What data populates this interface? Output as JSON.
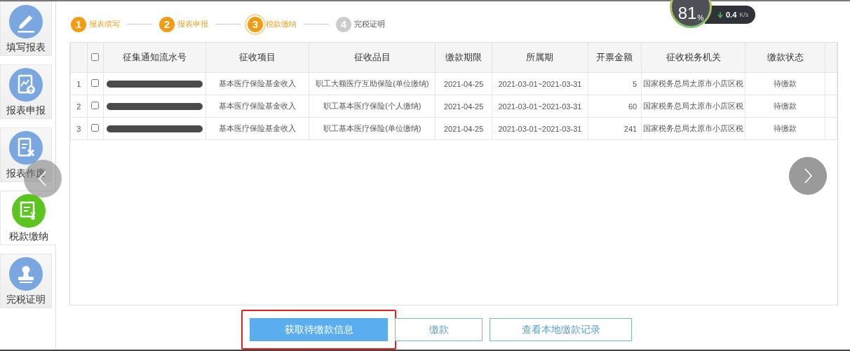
{
  "sidebar": {
    "items": [
      {
        "label": "填写报表",
        "selected": false
      },
      {
        "label": "报表申报",
        "selected": false
      },
      {
        "label": "报表作废",
        "selected": false
      },
      {
        "label": "税款缴纳",
        "selected": true
      },
      {
        "label": "完税证明",
        "selected": false
      }
    ]
  },
  "steps": [
    {
      "number": "1",
      "label": "报表填写",
      "kind": "done"
    },
    {
      "number": "2",
      "label": "报表申报",
      "kind": "done"
    },
    {
      "number": "3",
      "label": "税款缴纳",
      "kind": "current"
    },
    {
      "number": "4",
      "label": "完税证明",
      "kind": "todo"
    }
  ],
  "table": {
    "select_all": {
      "checked": false
    },
    "columns": [
      "征集通知流水号",
      "征收项目",
      "征收品目",
      "缴款期限",
      "所属期",
      "开票金额",
      "征收税务机关",
      "缴款状态"
    ],
    "rows": [
      {
        "index": "1",
        "checked": false,
        "item": "基本医疗保险基金收入",
        "category": "职工大额医疗互助保险(单位缴纳)",
        "deadline": "2021-04-25",
        "period": "2021-03-01~2021-03-31",
        "amount": "5",
        "authority": "国家税务总局太原市小店区税",
        "status": "待缴款"
      },
      {
        "index": "2",
        "checked": false,
        "item": "基本医疗保险基金收入",
        "category": "职工基本医疗保险(个人缴纳)",
        "deadline": "2021-04-25",
        "period": "2021-03-01~2021-03-31",
        "amount": "60",
        "authority": "国家税务总局太原市小店区税",
        "status": "待缴款"
      },
      {
        "index": "3",
        "checked": false,
        "item": "基本医疗保险基金收入",
        "category": "职工基本医疗保险(单位缴纳)",
        "deadline": "2021-04-25",
        "period": "2021-03-01~2021-03-31",
        "amount": "241",
        "authority": "国家税务总局太原市小店区税",
        "status": "待缴款"
      }
    ]
  },
  "buttons": [
    {
      "label": "获取待缴款信息",
      "kind": "primary",
      "highlighted": true
    },
    {
      "label": "缴款",
      "kind": "outline",
      "highlighted": false
    },
    {
      "label": "查看本地缴款记录",
      "kind": "outline",
      "highlighted": false
    }
  ],
  "speed_widget": {
    "percent": "81",
    "percent_unit": "%",
    "speed": "0.4",
    "speed_unit": "K/s"
  }
}
